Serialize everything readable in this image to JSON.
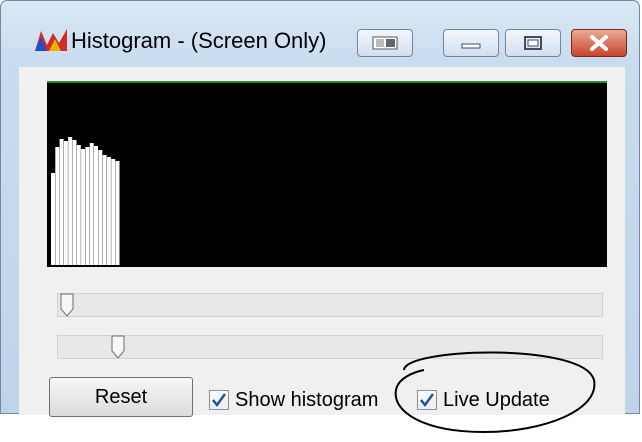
{
  "window": {
    "title": "Histogram - (Screen Only)"
  },
  "titlebar_icons": {
    "app": "histogram-app-icon",
    "extra": "window-extra-icon",
    "minimize": "minimize-icon",
    "maximize": "maximize-icon",
    "close": "close-icon"
  },
  "histogram": {
    "bars": [
      92,
      118,
      126,
      124,
      128,
      125,
      120,
      116,
      118,
      122,
      119,
      115,
      110,
      108,
      106,
      104
    ]
  },
  "controls": {
    "reset_label": "Reset",
    "show_histogram_label": "Show histogram",
    "show_histogram_checked": true,
    "live_update_label": "Live Update",
    "live_update_checked": true,
    "slider1_value": 0,
    "slider2_value": 0.1
  },
  "colors": {
    "canvas": "#000000",
    "bar": "#ffffff",
    "highlight": "#000000"
  }
}
